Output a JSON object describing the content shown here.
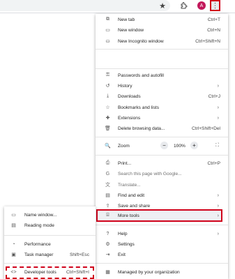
{
  "toolbar": {
    "star_icon": "★",
    "extensions_icon": "puzzle-icon",
    "avatar_letter": "A",
    "menu_icon": "⋮"
  },
  "menu": {
    "new_tab": {
      "label": "New tab",
      "shortcut": "Ctrl+T"
    },
    "new_window": {
      "label": "New window",
      "shortcut": "Ctrl+N"
    },
    "new_incognito": {
      "label": "New Incognito window",
      "shortcut": "Ctrl+Shift+N"
    },
    "passwords": {
      "label": "Passwords and autofill"
    },
    "history": {
      "label": "History"
    },
    "downloads": {
      "label": "Downloads",
      "shortcut": "Ctrl+J"
    },
    "bookmarks": {
      "label": "Bookmarks and lists"
    },
    "extensions": {
      "label": "Extensions"
    },
    "delete_browsing": {
      "label": "Delete browsing data...",
      "shortcut": "Ctrl+Shift+Del"
    },
    "zoom": {
      "label": "Zoom",
      "minus": "−",
      "value": "100%",
      "plus": "+"
    },
    "print": {
      "label": "Print...",
      "shortcut": "Ctrl+P"
    },
    "search_page": {
      "label": "Search this page with Google..."
    },
    "translate": {
      "label": "Translate..."
    },
    "find_edit": {
      "label": "Find and edit"
    },
    "save_share": {
      "label": "Save and share"
    },
    "more_tools": {
      "label": "More tools"
    },
    "help": {
      "label": "Help"
    },
    "settings": {
      "label": "Settings"
    },
    "exit": {
      "label": "Exit"
    },
    "managed": {
      "label": "Managed by your organization"
    }
  },
  "submenu": {
    "name_window": {
      "label": "Name window..."
    },
    "reading_mode": {
      "label": "Reading mode"
    },
    "performance": {
      "label": "Performance"
    },
    "task_manager": {
      "label": "Task manager",
      "shortcut": "Shift+Esc"
    },
    "developer_tools": {
      "label": "Developer tools",
      "shortcut": "Ctrl+Shift+I"
    }
  },
  "colors": {
    "highlight_border": "#d0021b",
    "avatar": "#c2185b"
  }
}
